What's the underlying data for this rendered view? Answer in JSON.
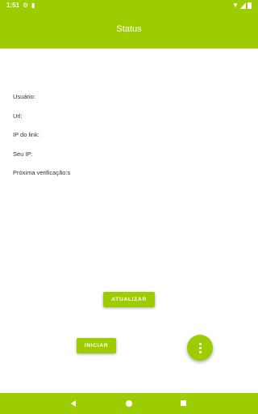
{
  "status_bar": {
    "time": "1:51",
    "icons": [
      "gear-icon",
      "clipboard-icon",
      "wifi-icon",
      "cell-signal-icon",
      "battery-icon"
    ]
  },
  "app_bar": {
    "title": "Status"
  },
  "info": {
    "usuario_label": "Usuário:",
    "url_label": "Url:",
    "ip_link_label": "IP do link:",
    "seu_ip_label": "Seu IP:",
    "proxima_verificacao_label": "Próxima verificação:s"
  },
  "buttons": {
    "atualizar": "ATUALIZAR",
    "iniciar": "INICIAR"
  },
  "fab": {
    "icon": "more-vert-icon"
  },
  "nav_bar": {
    "icons": [
      "back-icon",
      "home-icon",
      "recents-icon"
    ]
  },
  "colors": {
    "accent": "#9dcd00",
    "background": "#ffffff",
    "text": "#333333"
  }
}
